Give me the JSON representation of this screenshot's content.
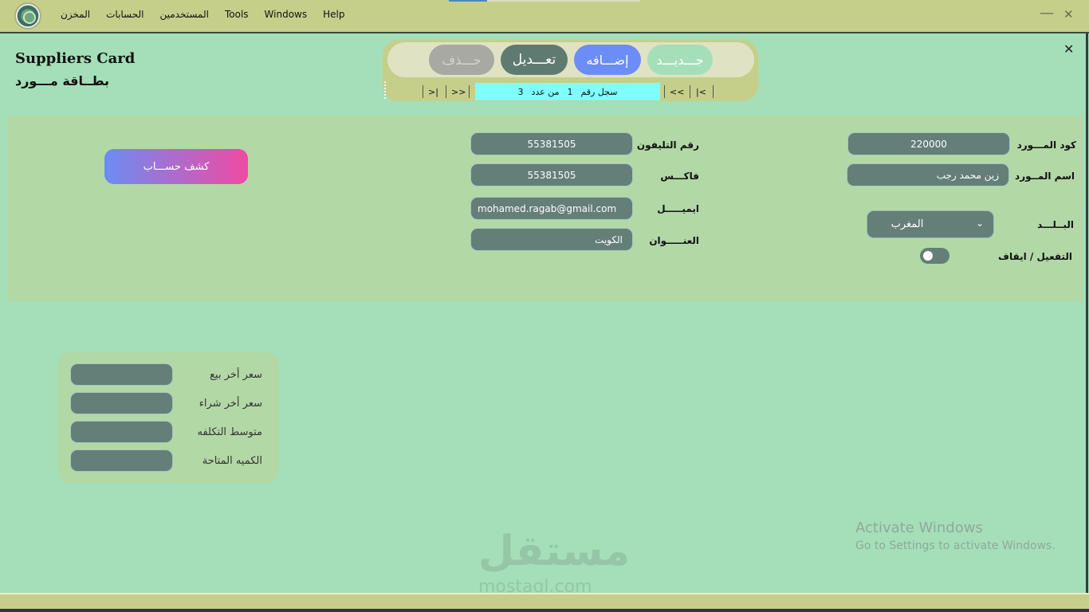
{
  "app": {
    "logo": "app-seal-logo",
    "menu": [
      "المخزن",
      "الحسابات",
      "المستخدمين",
      "Tools",
      "Windows",
      "Help"
    ],
    "window_controls": {
      "minimize": "—",
      "maximize": "▢",
      "close": "✕"
    }
  },
  "form": {
    "title_en": "Suppliers Card",
    "title_ar": "بطــاقة مـــورد",
    "close": "✕"
  },
  "toolbar": {
    "delete_label": "حـــذف",
    "edit_label": "تعـــديل",
    "add_label": "إضـــافه",
    "new_label": "جـــديـــد"
  },
  "navigator": {
    "first": "|<",
    "prev": "<<",
    "next": ">>",
    "last": ">|",
    "record_label": "سجل رقم",
    "record_number": "1",
    "of_label": "من عدد",
    "total": "3"
  },
  "fields": {
    "supplier_code_label": "كود المـــورد",
    "supplier_code": "220000",
    "supplier_name_label": "اسم المــورد",
    "supplier_name": "زين محمد رجب",
    "country_label": "البــلـــد",
    "country": "المغرب",
    "active_label": "التفعيل / ايقاف",
    "phone_label": "رقم التليفون",
    "phone": "55381505",
    "fax_label": "فاكـــس",
    "fax": "55381505",
    "email_label": "ايميـــــل",
    "email": "mohamed.ragab@gmail.com",
    "address_label": "العنـــــوان",
    "address": "الكويت"
  },
  "actions": {
    "statement_label": "كشف حســـاب"
  },
  "prices": {
    "last_sale_label": "سعر أخر بيع",
    "last_purchase_label": "سعر أخر شراء",
    "avg_cost_label": "متوسط التكلفه",
    "available_qty_label": "الكميه المتاحة"
  },
  "watermark": {
    "activate_title": "Activate Windows",
    "activate_sub": "Go to Settings to activate Windows.",
    "site_logo": "مستقل",
    "site_domain": "mostaql.com"
  }
}
